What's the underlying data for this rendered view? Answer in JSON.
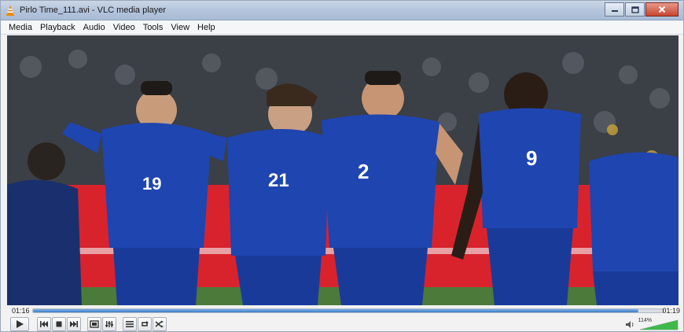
{
  "window": {
    "title": "Pirlo Time_111.avi - VLC media player",
    "icon": "vlc-cone-icon"
  },
  "menubar": {
    "items": [
      "Media",
      "Playback",
      "Audio",
      "Video",
      "Tools",
      "View",
      "Help"
    ]
  },
  "player": {
    "time_elapsed": "01:16",
    "time_total": "01:19",
    "progress_fraction": 0.96,
    "volume_percent": "114%",
    "volume_fraction": 1.0
  },
  "video_frame": {
    "description_icon": "video-frame",
    "jersey_numbers": [
      "19",
      "21",
      "2",
      "9"
    ]
  },
  "controls": {
    "buttons": [
      "play-icon",
      "previous-icon",
      "stop-icon",
      "next-icon",
      "fullscreen-icon",
      "extended-settings-icon",
      "playlist-icon",
      "loop-icon",
      "shuffle-icon",
      "speaker-icon"
    ]
  },
  "colors": {
    "accent": "#3a7cc7",
    "jersey_blue": "#1f45b0",
    "close_red": "#c7462f"
  }
}
